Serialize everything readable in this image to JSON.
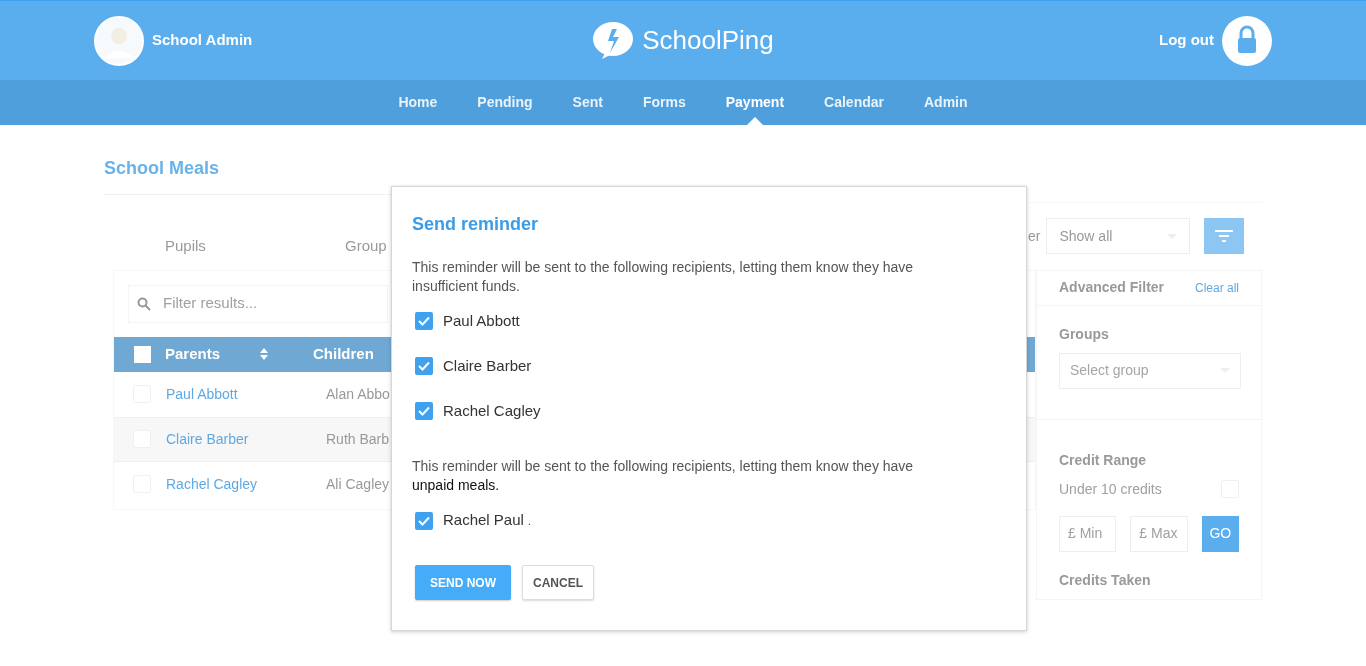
{
  "header": {
    "user": "School Admin",
    "logo": "SchoolPing",
    "logout": "Log out"
  },
  "nav": [
    {
      "label": "Home",
      "selected": false
    },
    {
      "label": "Pending",
      "selected": false
    },
    {
      "label": "Sent",
      "selected": false
    },
    {
      "label": "Forms",
      "selected": false
    },
    {
      "label": "Payment",
      "selected": true
    },
    {
      "label": "Calendar",
      "selected": false
    },
    {
      "label": "Admin",
      "selected": false
    }
  ],
  "page_title": "School Meals",
  "tabs": [
    "Pupils",
    "Group"
  ],
  "search": {
    "placeholder": "Filter results..."
  },
  "table": {
    "all_checked": false,
    "columns": [
      "Parents",
      "Children"
    ],
    "rows": [
      {
        "parent": "Paul Abbott",
        "child": "Alan Abbo",
        "checked": false,
        "highlighted": false
      },
      {
        "parent": "Claire Barber",
        "child": "Ruth Barb",
        "checked": false,
        "highlighted": true
      },
      {
        "parent": "Rachel Cagley",
        "child": "Ali Cagley",
        "checked": false,
        "highlighted": false
      }
    ]
  },
  "filter": {
    "label": "er",
    "select": "Show all"
  },
  "advanced": {
    "title": "Advanced Filter",
    "clear": "Clear all",
    "groups_label": "Groups",
    "groups_placeholder": "Select group",
    "credit_range": "Credit Range",
    "under_label": "Under 10 credits",
    "under_checked": false,
    "currency_min": "£",
    "min_placeholder": "Min",
    "currency_max": "£",
    "max_placeholder": "Max",
    "go": "GO",
    "credits_taken": "Credits Taken"
  },
  "dialog": {
    "title": "Send reminder",
    "sections": [
      {
        "message": "This reminder will be sent to the following recipients, letting them know they have",
        "tail": "insufficient funds.",
        "tail_dark": false,
        "recipients": [
          {
            "name": "Paul Abbott",
            "checked": true
          },
          {
            "name": "Claire Barber",
            "checked": true
          },
          {
            "name": "Rachel Cagley",
            "checked": true
          }
        ]
      },
      {
        "message": "This reminder will be sent to the following recipients, letting them know they have",
        "tail": "unpaid meals.",
        "tail_dark": true,
        "recipients": [
          {
            "name": "Rachel Paul",
            "suffix": ".",
            "checked": true
          }
        ]
      }
    ],
    "send": "SEND NOW",
    "cancel": "CANCEL"
  }
}
